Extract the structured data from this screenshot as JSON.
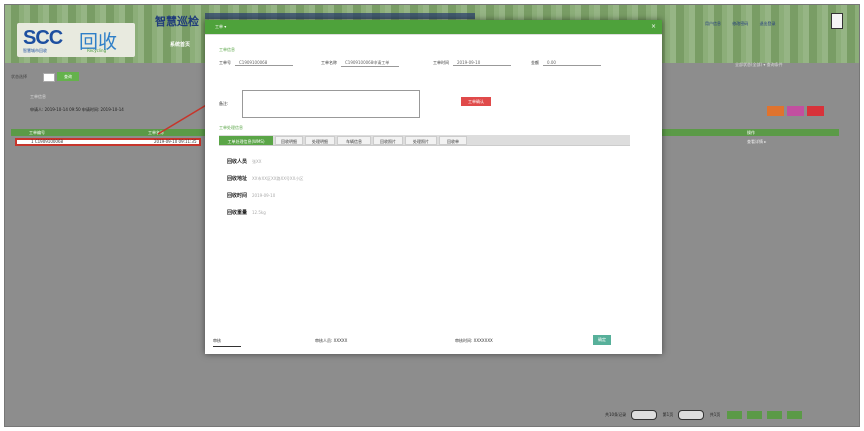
{
  "header": {
    "system_title": "智慧巡检",
    "tag": "系统首页",
    "logo": {
      "brand": "SCC",
      "mark": "回收",
      "sub": "智慧城市回收",
      "en": "Recycling"
    },
    "links": [
      "用户信息",
      "修改密码",
      "退出登录"
    ]
  },
  "toolbar": {
    "select_label": "状态选择",
    "query_label": "查询",
    "right_select": "全部状态(全部)  ▾  查询条件"
  },
  "info": {
    "title": "工单信息",
    "line": "申请人: 2019-10-14 09:50    申请时间: 2019-10-14"
  },
  "action_colors": [
    "#e0732e",
    "#c24fa0",
    "#d8323a"
  ],
  "grid": {
    "columns": [
      "工单编号",
      "工单名称",
      "操作"
    ],
    "selected_row": {
      "id": "1 C1909100068",
      "name": "2019-09-10 09:11:35"
    },
    "row_right": "查看详情 ▸"
  },
  "pager": {
    "label": "共10条记录",
    "page_label": "第1页",
    "total": "共1页",
    "buttons": 4
  },
  "dialog": {
    "tab": "工单  ▾",
    "close": "×",
    "section1": "工单信息",
    "fields": [
      {
        "label": "工单号",
        "value": "C1909100068"
      },
      {
        "label": "工单名称",
        "value": "C1909100068申请工单"
      },
      {
        "label": "工单时间",
        "value": "2019-09-10"
      },
      {
        "label": "金额",
        "value": "0.00"
      }
    ],
    "remark_label": "备注:",
    "red_button": "工单确认",
    "section2": "工单处理信息",
    "tabs": [
      "工单处理信息(WMS)",
      "回收明细",
      "处理明细",
      "车辆信息",
      "回收照片",
      "处理照片",
      "回收单"
    ],
    "details": [
      {
        "label": "回收人员",
        "value": "张XX"
      },
      {
        "label": "回收地址",
        "value": "XX市XX区XX路XX号XX小区"
      },
      {
        "label": "回收时间",
        "value": "2019-09-10"
      },
      {
        "label": "回收重量",
        "value": "12.5kg"
      }
    ],
    "footer": {
      "left": "审核",
      "mid": "审核人员: XXXXX",
      "right": "审核时间: XXXXXXX",
      "button": "确定"
    }
  }
}
